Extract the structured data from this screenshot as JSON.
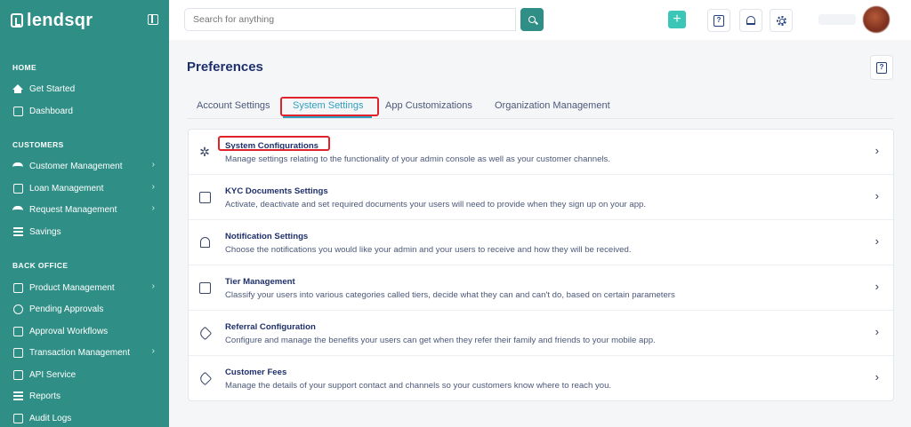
{
  "brand": {
    "name": "lendsqr"
  },
  "sidebar": {
    "sections": [
      {
        "label": "HOME",
        "items": [
          {
            "label": "Get Started",
            "icon": "home-icon",
            "chevron": false
          },
          {
            "label": "Dashboard",
            "icon": "dashboard-icon",
            "chevron": false
          }
        ]
      },
      {
        "label": "CUSTOMERS",
        "items": [
          {
            "label": "Customer Management",
            "icon": "users-icon",
            "chevron": true
          },
          {
            "label": "Loan Management",
            "icon": "loan-icon",
            "chevron": true
          },
          {
            "label": "Request Management",
            "icon": "request-icon",
            "chevron": true
          },
          {
            "label": "Savings",
            "icon": "savings-icon",
            "chevron": false
          }
        ]
      },
      {
        "label": "BACK OFFICE",
        "items": [
          {
            "label": "Product Management",
            "icon": "product-icon",
            "chevron": true
          },
          {
            "label": "Pending Approvals",
            "icon": "clock-icon",
            "chevron": false
          },
          {
            "label": "Approval Workflows",
            "icon": "workflow-icon",
            "chevron": false
          },
          {
            "label": "Transaction Management",
            "icon": "transaction-icon",
            "chevron": true
          },
          {
            "label": "API Service",
            "icon": "api-icon",
            "chevron": false
          },
          {
            "label": "Reports",
            "icon": "reports-icon",
            "chevron": false
          },
          {
            "label": "Audit Logs",
            "icon": "audit-icon",
            "chevron": false
          }
        ]
      }
    ],
    "chevron_glyph": "›"
  },
  "search": {
    "placeholder": "Search for anything"
  },
  "toolbar": {
    "plus_glyph": "+",
    "help_glyph": "?"
  },
  "page": {
    "title": "Preferences"
  },
  "tabs": [
    {
      "label": "Account Settings",
      "active": false
    },
    {
      "label": "System Settings",
      "active": true
    },
    {
      "label": "App Customizations",
      "active": false
    },
    {
      "label": "Organization Management",
      "active": false
    }
  ],
  "settings": [
    {
      "title": "System Configurations",
      "description": "Manage settings relating to the functionality of your admin console as well as your customer channels.",
      "icon": "network-icon"
    },
    {
      "title": "KYC Documents Settings",
      "description": "Activate, deactivate and set required documents your users will need to provide when they sign up on your app.",
      "icon": "document-scan-icon"
    },
    {
      "title": "Notification Settings",
      "description": "Choose the notifications you would like your admin and your users to receive and how they will be received.",
      "icon": "bell-icon"
    },
    {
      "title": "Tier Management",
      "description": "Classify your users into various categories called tiers, decide what they can and can't do, based on certain parameters",
      "icon": "id-card-icon"
    },
    {
      "title": "Referral Configuration",
      "description": "Configure and manage the benefits your users can get when they refer their family and friends to your mobile app.",
      "icon": "referral-tag-icon"
    },
    {
      "title": "Customer Fees",
      "description": "Manage the details of your support contact and channels so your customers know where to reach you.",
      "icon": "tag-icon"
    }
  ],
  "colors": {
    "sidebar": "#2f8f86",
    "accent": "#2f9fbf",
    "highlight": "#e0232b",
    "title": "#1e2f6b"
  }
}
